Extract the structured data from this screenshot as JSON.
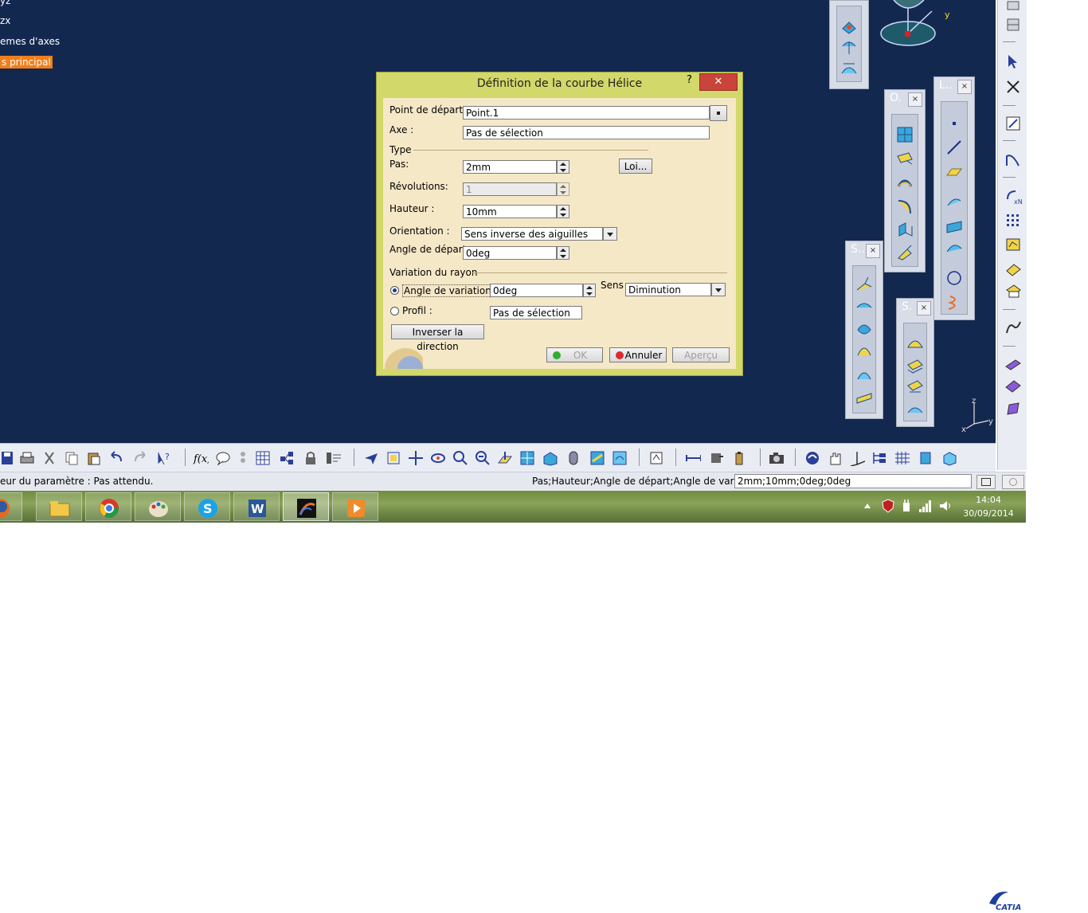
{
  "tree": {
    "items": [
      {
        "label": "yz"
      },
      {
        "label": "zx"
      },
      {
        "label": "emes d'axes"
      },
      {
        "label": "s principal"
      }
    ]
  },
  "compass": {
    "y": "y"
  },
  "axis_triad": {
    "z": "z",
    "y": "y",
    "x": "x"
  },
  "floating_toolbars": {
    "o": {
      "title": "O.",
      "close": "×"
    },
    "l": {
      "title": "L..",
      "close": "×"
    },
    "s1": {
      "title": "S..",
      "close": "×"
    },
    "s2": {
      "title": "S.",
      "close": "×"
    }
  },
  "dialog": {
    "title": "Définition de la courbe Hélice",
    "help": "?",
    "close": "✕",
    "start_point_label": "Point de départ :",
    "start_point_value": "Point.1",
    "axis_label": "Axe :",
    "axis_value": "Pas de sélection",
    "type_group": "Type",
    "pitch_label": "Pas:",
    "pitch_value": "2mm",
    "law_button": "Loi...",
    "revolutions_label": "Révolutions:",
    "revolutions_value": "1",
    "height_label": "Hauteur :",
    "height_value": "10mm",
    "orientation_label": "Orientation :",
    "orientation_value": "Sens inverse des aiguilles",
    "start_angle_label": "Angle de départ :",
    "start_angle_value": "0deg",
    "radius_group": "Variation du rayon",
    "variation_angle_label": "Angle de variation:",
    "variation_angle_value": "0deg",
    "direction_label": "Sens :",
    "direction_value": "Diminution",
    "profile_label": "Profil :",
    "profile_value": "Pas de sélection",
    "invert_button": "Inverser la direction",
    "ok_button": "OK",
    "cancel_button": "Annuler",
    "preview_button": "Aperçu"
  },
  "bottom_toolbar": {
    "catia_logo": "CATIA"
  },
  "statusbar": {
    "left_text": "eur du paramètre : Pas attendu.",
    "prompt": "Pas;Hauteur;Angle de départ;Angle de variation",
    "input_value": "2mm;10mm;0deg;0deg"
  },
  "taskbar": {
    "apps": [
      "firefox-icon",
      "file-explorer-icon",
      "chrome-icon",
      "paint-icon",
      "skype-icon",
      "word-icon",
      "catia-app-icon",
      "media-player-icon"
    ],
    "time": "14:04",
    "date": "30/09/2014"
  },
  "colors": {
    "viewport": "#13284f",
    "dialog_frame": "#d2d86a",
    "dialog_body": "#f5e8c7",
    "selection": "#f07f1a",
    "close_red": "#c9443a"
  }
}
